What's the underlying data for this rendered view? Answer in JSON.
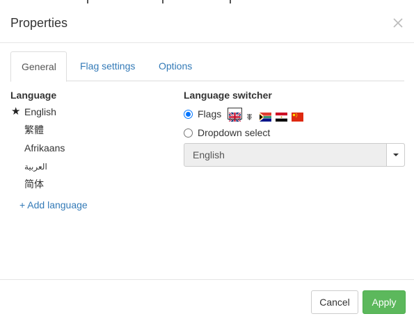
{
  "dialog": {
    "title": "Properties",
    "tabs": [
      {
        "label": "General",
        "active": true
      },
      {
        "label": "Flag settings",
        "active": false
      },
      {
        "label": "Options",
        "active": false
      }
    ]
  },
  "language": {
    "heading": "Language",
    "items": [
      {
        "label": "English",
        "default": true
      },
      {
        "label": "繁體",
        "default": false
      },
      {
        "label": "Afrikaans",
        "default": false
      },
      {
        "label": "العربية",
        "default": false
      },
      {
        "label": "简体",
        "default": false
      }
    ],
    "add_label": "+ Add language"
  },
  "switcher": {
    "heading": "Language switcher",
    "options": [
      {
        "label": "Flags",
        "checked": true
      },
      {
        "label": "Dropdown select",
        "checked": false
      }
    ],
    "flags": [
      "uk-flag-icon",
      "traditional-chinese-flag-icon",
      "south-africa-flag-icon",
      "egypt-flag-icon",
      "china-flag-icon"
    ],
    "dropdown_value": "English"
  },
  "footer": {
    "cancel_label": "Cancel",
    "apply_label": "Apply"
  },
  "colors": {
    "link": "#337ab7",
    "apply": "#5cb85c",
    "radio_checked": "#0075ff"
  }
}
